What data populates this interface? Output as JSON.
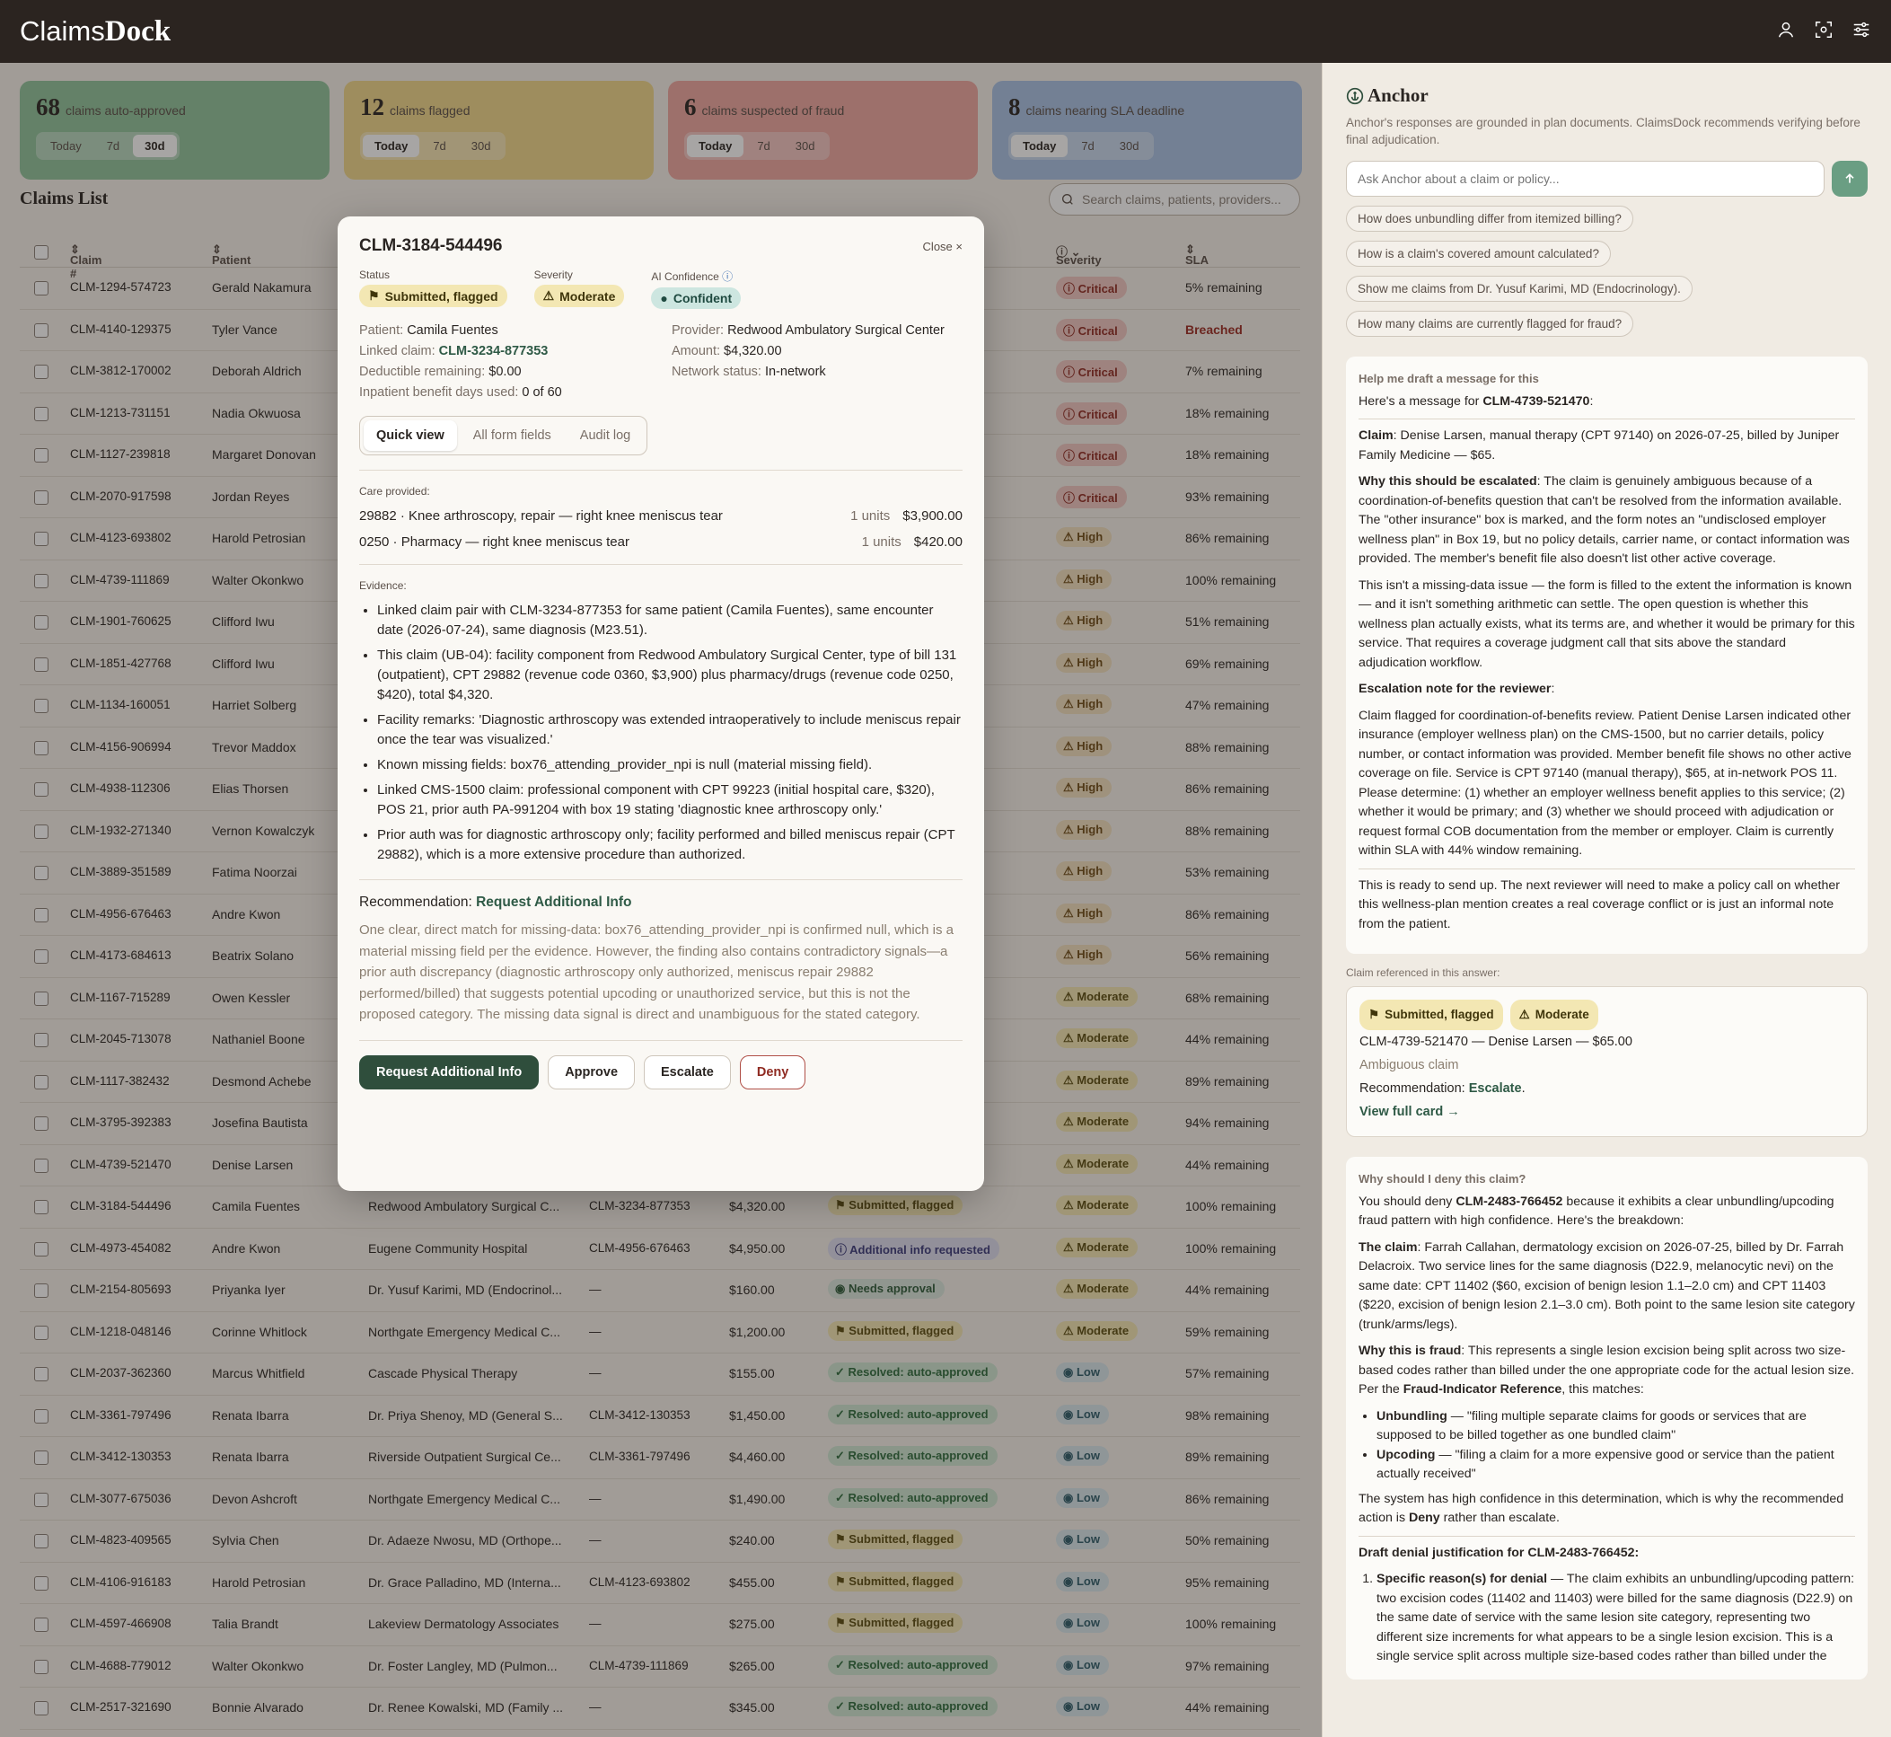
{
  "app": {
    "brand_light": "Claims",
    "brand_bold": "Dock"
  },
  "stats": [
    {
      "num": "68",
      "label": "claims auto-approved",
      "color": "#8fc49c",
      "active": "30d"
    },
    {
      "num": "12",
      "label": "claims flagged",
      "color": "#f0d88a",
      "active": "Today"
    },
    {
      "num": "6",
      "label": "claims suspected of fraud",
      "color": "#eea7a0",
      "active": "Today"
    },
    {
      "num": "8",
      "label": "claims nearing SLA deadline",
      "color": "#a9c2e4",
      "active": "Today"
    }
  ],
  "ranges": [
    "Today",
    "7d",
    "30d"
  ],
  "list": {
    "title": "Claims List",
    "search_placeholder": "Search claims, patients, providers..."
  },
  "columns": {
    "claim": "Claim #",
    "patient": "Patient",
    "severity": "Severity",
    "sla": "SLA"
  },
  "rows": [
    {
      "id": "CLM-1294-574723",
      "patient": "Gerald Nakamura",
      "provider": "",
      "linked": "",
      "amount": "",
      "status": "",
      "status_type": "",
      "severity": "Critical",
      "sla": "5% remaining"
    },
    {
      "id": "CLM-4140-129375",
      "patient": "Tyler Vance",
      "provider": "",
      "linked": "",
      "amount": "",
      "status": "",
      "status_type": "",
      "severity": "Critical",
      "sla": "Breached"
    },
    {
      "id": "CLM-3812-170002",
      "patient": "Deborah Aldrich",
      "provider": "",
      "linked": "",
      "amount": "",
      "status": "",
      "status_type": "",
      "severity": "Critical",
      "sla": "7% remaining"
    },
    {
      "id": "CLM-1213-731151",
      "patient": "Nadia Okwuosa",
      "provider": "",
      "linked": "",
      "amount": "",
      "status": "",
      "status_type": "",
      "severity": "Critical",
      "sla": "18% remaining"
    },
    {
      "id": "CLM-1127-239818",
      "patient": "Margaret Donovan",
      "provider": "",
      "linked": "",
      "amount": "",
      "status": "",
      "status_type": "",
      "severity": "Critical",
      "sla": "18% remaining"
    },
    {
      "id": "CLM-2070-917598",
      "patient": "Jordan Reyes",
      "provider": "",
      "linked": "",
      "amount": "",
      "status": "",
      "status_type": "",
      "severity": "Critical",
      "sla": "93% remaining"
    },
    {
      "id": "CLM-4123-693802",
      "patient": "Harold Petrosian",
      "provider": "",
      "linked": "",
      "amount": "",
      "status": "",
      "status_type": "",
      "severity": "High",
      "sla": "86% remaining"
    },
    {
      "id": "CLM-4739-111869",
      "patient": "Walter Okonkwo",
      "provider": "",
      "linked": "",
      "amount": "",
      "status": "",
      "status_type": "",
      "severity": "High",
      "sla": "100% remaining"
    },
    {
      "id": "CLM-1901-760625",
      "patient": "Clifford Iwu",
      "provider": "",
      "linked": "",
      "amount": "",
      "status": "",
      "status_type": "",
      "severity": "High",
      "sla": "51% remaining"
    },
    {
      "id": "CLM-1851-427768",
      "patient": "Clifford Iwu",
      "provider": "",
      "linked": "",
      "amount": "",
      "status": "",
      "status_type": "",
      "severity": "High",
      "sla": "69% remaining"
    },
    {
      "id": "CLM-1134-160051",
      "patient": "Harriet Solberg",
      "provider": "",
      "linked": "",
      "amount": "",
      "status": "",
      "status_type": "",
      "severity": "High",
      "sla": "47% remaining"
    },
    {
      "id": "CLM-4156-906994",
      "patient": "Trevor Maddox",
      "provider": "",
      "linked": "",
      "amount": "",
      "status": "",
      "status_type": "",
      "severity": "High",
      "sla": "88% remaining"
    },
    {
      "id": "CLM-4938-112306",
      "patient": "Elias Thorsen",
      "provider": "",
      "linked": "",
      "amount": "",
      "status": "",
      "status_type": "",
      "severity": "High",
      "sla": "86% remaining"
    },
    {
      "id": "CLM-1932-271340",
      "patient": "Vernon Kowalczyk",
      "provider": "",
      "linked": "",
      "amount": "",
      "status": "",
      "status_type": "",
      "severity": "High",
      "sla": "88% remaining"
    },
    {
      "id": "CLM-3889-351589",
      "patient": "Fatima Noorzai",
      "provider": "",
      "linked": "",
      "amount": "",
      "status": "",
      "status_type": "",
      "severity": "High",
      "sla": "53% remaining"
    },
    {
      "id": "CLM-4956-676463",
      "patient": "Andre Kwon",
      "provider": "",
      "linked": "",
      "amount": "",
      "status": "",
      "status_type": "",
      "severity": "High",
      "sla": "86% remaining"
    },
    {
      "id": "CLM-4173-684613",
      "patient": "Beatrix Solano",
      "provider": "",
      "linked": "",
      "amount": "",
      "status": "",
      "status_type": "",
      "severity": "High",
      "sla": "56% remaining"
    },
    {
      "id": "CLM-1167-715289",
      "patient": "Owen Kessler",
      "provider": "",
      "linked": "",
      "amount": "",
      "status": "",
      "status_type": "",
      "severity": "Moderate",
      "sla": "68% remaining"
    },
    {
      "id": "CLM-2045-713078",
      "patient": "Nathaniel Boone",
      "provider": "",
      "linked": "",
      "amount": "",
      "status": "",
      "status_type": "",
      "severity": "Moderate",
      "sla": "44% remaining"
    },
    {
      "id": "CLM-1117-382432",
      "patient": "Desmond Achebe",
      "provider": "",
      "linked": "",
      "amount": "",
      "status": "",
      "status_type": "",
      "severity": "Moderate",
      "sla": "89% remaining"
    },
    {
      "id": "CLM-3795-392383",
      "patient": "Josefina Bautista",
      "provider": "",
      "linked": "",
      "amount": "",
      "status": "",
      "status_type": "",
      "severity": "Moderate",
      "sla": "94% remaining"
    },
    {
      "id": "CLM-4739-521470",
      "patient": "Denise Larsen",
      "provider": "",
      "linked": "",
      "amount": "",
      "status": "",
      "status_type": "",
      "severity": "Moderate",
      "sla": "44% remaining"
    },
    {
      "id": "CLM-3184-544496",
      "patient": "Camila Fuentes",
      "provider": "Redwood Ambulatory Surgical C...",
      "linked": "CLM-3234-877353",
      "amount": "$4,320.00",
      "status": "Submitted, flagged",
      "status_type": "flag",
      "severity": "Moderate",
      "sla": "100% remaining"
    },
    {
      "id": "CLM-4973-454082",
      "patient": "Andre Kwon",
      "provider": "Eugene Community Hospital",
      "linked": "CLM-4956-676463",
      "amount": "$4,950.00",
      "status": "Additional info requested",
      "status_type": "info",
      "severity": "Moderate",
      "sla": "100% remaining"
    },
    {
      "id": "CLM-2154-805693",
      "patient": "Priyanka Iyer",
      "provider": "Dr. Yusuf Karimi, MD (Endocrinol...",
      "linked": "—",
      "amount": "$160.00",
      "status": "Needs approval",
      "status_type": "approve",
      "severity": "Moderate",
      "sla": "44% remaining"
    },
    {
      "id": "CLM-1218-048146",
      "patient": "Corinne Whitlock",
      "provider": "Northgate Emergency Medical C...",
      "linked": "—",
      "amount": "$1,200.00",
      "status": "Submitted, flagged",
      "status_type": "flag",
      "severity": "Moderate",
      "sla": "59% remaining"
    },
    {
      "id": "CLM-2037-362360",
      "patient": "Marcus Whitfield",
      "provider": "Cascade Physical Therapy",
      "linked": "—",
      "amount": "$155.00",
      "status": "Resolved: auto-approved",
      "status_type": "auto",
      "severity": "Low",
      "sla": "57% remaining"
    },
    {
      "id": "CLM-3361-797496",
      "patient": "Renata Ibarra",
      "provider": "Dr. Priya Shenoy, MD (General S...",
      "linked": "CLM-3412-130353",
      "amount": "$1,450.00",
      "status": "Resolved: auto-approved",
      "status_type": "auto",
      "severity": "Low",
      "sla": "98% remaining"
    },
    {
      "id": "CLM-3412-130353",
      "patient": "Renata Ibarra",
      "provider": "Riverside Outpatient Surgical Ce...",
      "linked": "CLM-3361-797496",
      "amount": "$4,460.00",
      "status": "Resolved: auto-approved",
      "status_type": "auto",
      "severity": "Low",
      "sla": "89% remaining"
    },
    {
      "id": "CLM-3077-675036",
      "patient": "Devon Ashcroft",
      "provider": "Northgate Emergency Medical C...",
      "linked": "—",
      "amount": "$1,490.00",
      "status": "Resolved: auto-approved",
      "status_type": "auto",
      "severity": "Low",
      "sla": "86% remaining"
    },
    {
      "id": "CLM-4823-409565",
      "patient": "Sylvia Chen",
      "provider": "Dr. Adaeze Nwosu, MD (Orthope...",
      "linked": "—",
      "amount": "$240.00",
      "status": "Submitted, flagged",
      "status_type": "flag",
      "severity": "Low",
      "sla": "50% remaining"
    },
    {
      "id": "CLM-4106-916183",
      "patient": "Harold Petrosian",
      "provider": "Dr. Grace Palladino, MD (Interna...",
      "linked": "CLM-4123-693802",
      "amount": "$455.00",
      "status": "Submitted, flagged",
      "status_type": "flag",
      "severity": "Low",
      "sla": "95% remaining"
    },
    {
      "id": "CLM-4597-466908",
      "patient": "Talia Brandt",
      "provider": "Lakeview Dermatology Associates",
      "linked": "—",
      "amount": "$275.00",
      "status": "Submitted, flagged",
      "status_type": "flag",
      "severity": "Low",
      "sla": "100% remaining"
    },
    {
      "id": "CLM-4688-779012",
      "patient": "Walter Okonkwo",
      "provider": "Dr. Foster Langley, MD (Pulmon...",
      "linked": "CLM-4739-111869",
      "amount": "$265.00",
      "status": "Resolved: auto-approved",
      "status_type": "auto",
      "severity": "Low",
      "sla": "97% remaining"
    },
    {
      "id": "CLM-2517-321690",
      "patient": "Bonnie Alvarado",
      "provider": "Dr. Renee Kowalski, MD (Family ...",
      "linked": "—",
      "amount": "$345.00",
      "status": "Resolved: auto-approved",
      "status_type": "auto",
      "severity": "Low",
      "sla": "44% remaining"
    }
  ],
  "modal": {
    "title": "CLM-3184-544496",
    "close": "Close ×",
    "status_label": "Status",
    "status": "Submitted, flagged",
    "severity_label": "Severity",
    "severity": "Moderate",
    "ai_label": "AI Confidence",
    "ai": "Confident",
    "patient_k": "Patient:",
    "patient_v": "Camila Fuentes",
    "provider_k": "Provider:",
    "provider_v": "Redwood Ambulatory Surgical Center",
    "linked_k": "Linked claim:",
    "linked_v": "CLM-3234-877353",
    "amount_k": "Amount:",
    "amount_v": "$4,320.00",
    "deduct_k": "Deductible remaining:",
    "deduct_v": "$0.00",
    "network_k": "Network status:",
    "network_v": "In-network",
    "inpat_k": "Inpatient benefit days used:",
    "inpat_v": "0 of 60",
    "tabs": [
      "Quick view",
      "All form fields",
      "Audit log"
    ],
    "care_label": "Care provided:",
    "care": [
      {
        "desc": "29882 · Knee arthroscopy, repair — right knee meniscus tear",
        "units": "1 units",
        "amount": "$3,900.00"
      },
      {
        "desc": "0250 · Pharmacy — right knee meniscus tear",
        "units": "1 units",
        "amount": "$420.00"
      }
    ],
    "evidence_label": "Evidence:",
    "evidence": [
      "Linked claim pair with CLM-3234-877353 for same patient (Camila Fuentes), same encounter date (2026-07-24), same diagnosis (M23.51).",
      "This claim (UB-04): facility component from Redwood Ambulatory Surgical Center, type of bill 131 (outpatient), CPT 29882 (revenue code 0360, $3,900) plus pharmacy/drugs (revenue code 0250, $420), total $4,320.",
      "Facility remarks: 'Diagnostic arthroscopy was extended intraoperatively to include meniscus repair once the tear was visualized.'",
      "Known missing fields: box76_attending_provider_npi is null (material missing field).",
      "Linked CMS-1500 claim: professional component with CPT 99223 (initial hospital care, $320), POS 21, prior auth PA-991204 with box 19 stating 'diagnostic knee arthroscopy only.'",
      "Prior auth was for diagnostic arthroscopy only; facility performed and billed meniscus repair (CPT 29882), which is a more extensive procedure than authorized."
    ],
    "rec_label": "Recommendation:",
    "rec_value": "Request Additional Info",
    "rec_text": "One clear, direct match for missing-data: box76_attending_provider_npi is confirmed null, which is a material missing field per the evidence. However, the finding also contains contradictory signals—a prior auth discrepancy (diagnostic arthroscopy only authorized, meniscus repair 29882 performed/billed) that suggests potential upcoding or unauthorized service, but this is not the proposed category. The missing data signal is direct and unambiguous for the stated category.",
    "btn_request": "Request Additional Info",
    "btn_approve": "Approve",
    "btn_escalate": "Escalate",
    "btn_deny": "Deny"
  },
  "anchor": {
    "title": "Anchor",
    "disclaimer": "Anchor's responses are grounded in plan documents. ClaimsDock recommends verifying before final adjudication.",
    "ask_placeholder": "Ask Anchor about a claim or policy...",
    "suggestions": [
      "How does unbundling differ from itemized billing?",
      "How is a claim's covered amount calculated?",
      "Show me claims from Dr. Yusuf Karimi, MD (Endocrinology).",
      "How many claims are currently flagged for fraud?"
    ],
    "msg1": {
      "question": "Help me draft a message for this",
      "intro_pre": "Here's a message for ",
      "intro_id": "CLM-4739-521470",
      "intro_post": ":",
      "claim_k": "Claim",
      "claim_v": ": Denise Larsen, manual therapy (CPT 97140) on 2026-07-25, billed by Juniper Family Medicine — $65.",
      "why_k": "Why this should be escalated",
      "why_v": ": The claim is genuinely ambiguous because of a coordination-of-benefits question that can't be resolved from the information available. The \"other insurance\" box is marked, and the form notes an \"undisclosed employer wellness plan\" in Box 19, but no policy details, carrier name, or contact information was provided. The member's benefit file also doesn't list other active coverage.",
      "p3": "This isn't a missing-data issue — the form is filled to the extent the information is known — and it isn't something arithmetic can settle. The open question is whether this wellness plan actually exists, what its terms are, and whether it would be primary for this service. That requires a coverage judgment call that sits above the standard adjudication workflow.",
      "note_k": "Escalation note for the reviewer",
      "note_post": ":",
      "note": "Claim flagged for coordination-of-benefits review. Patient Denise Larsen indicated other insurance (employer wellness plan) on the CMS-1500, but no carrier details, policy number, or contact information was provided. Member benefit file shows no other active coverage on file. Service is CPT 97140 (manual therapy), $65, at in-network POS 11. Please determine: (1) whether an employer wellness benefit applies to this service; (2) whether it would be primary; and (3) whether we should proceed with adjudication or request formal COB documentation from the member or employer. Claim is currently within SLA with 44% window remaining.",
      "closing": "This is ready to send up. The next reviewer will need to make a policy call on whether this wellness-plan mention creates a real coverage conflict or is just an informal note from the patient."
    },
    "ref_label": "Claim referenced in this answer:",
    "ref": {
      "status": "Submitted, flagged",
      "severity": "Moderate",
      "line": "CLM-4739-521470 — Denise Larsen — $65.00",
      "sub": "Ambiguous claim",
      "rec_k": "Recommendation: ",
      "rec_v": "Escalate",
      "rec_post": ".",
      "view": "View full card →"
    },
    "msg2": {
      "question": "Why should I deny this claim?",
      "intro_pre": "You should deny ",
      "intro_id": "CLM-2483-766452",
      "intro_post": " because it exhibits a clear unbundling/upcoding fraud pattern with high confidence. Here's the breakdown:",
      "claim_k": "The claim",
      "claim_v": ": Farrah Callahan, dermatology excision on 2026-07-25, billed by Dr. Farrah Delacroix. Two service lines for the same diagnosis (D22.9, melanocytic nevi) on the same date: CPT 11402 ($60, excision of benign lesion 1.1–2.0 cm) and CPT 11403 ($220, excision of benign lesion 2.1–3.0 cm). Both point to the same lesion site category (trunk/arms/legs).",
      "fraud_k": "Why this is fraud",
      "fraud_v": ": This represents a single lesion excision being split across two size-based codes rather than billed under the one appropriate code for the actual lesion size. Per the ",
      "fraud_ref": "Fraud-Indicator Reference",
      "fraud_post": ", this matches:",
      "b1_k": "Unbundling",
      "b1_v": " — \"filing multiple separate claims for goods or services that are supposed to be billed together as one bundled claim\"",
      "b2_k": "Upcoding",
      "b2_v": " — \"filing a claim for a more expensive good or service than the patient actually received\"",
      "conf_pre": "The system has high confidence in this determination, which is why the recommended action is ",
      "conf_deny": "Deny",
      "conf_post": " rather than escalate.",
      "draft_title": "Draft denial justification for CLM-2483-766452:",
      "draft1_k": "Specific reason(s) for denial",
      "draft1_v": " — The claim exhibits an unbundling/upcoding pattern: two excision codes (11402 and 11403) were billed for the same diagnosis (D22.9) on the same date of service with the same lesion site category, representing two different size increments for what appears to be a single lesion excision. This is a single service split across multiple size-based codes rather than billed under the"
    }
  }
}
